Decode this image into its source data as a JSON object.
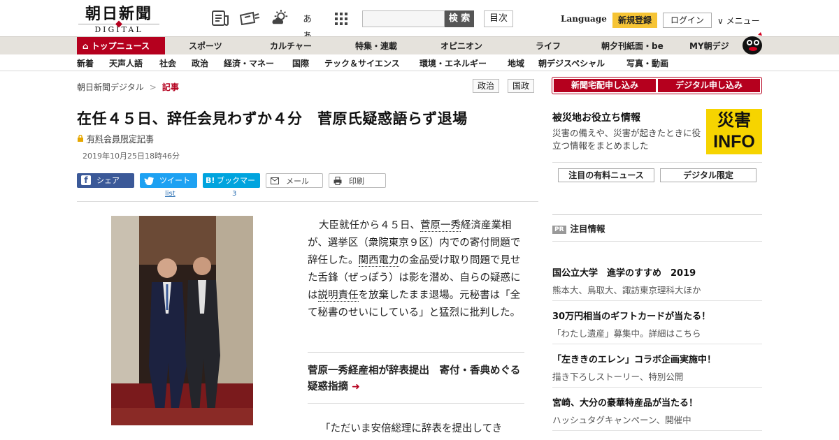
{
  "header": {
    "logo_jp": "朝日新聞",
    "logo_en": "DIGITAL",
    "icons": [
      "newspaper-icon",
      "delivery-icon",
      "weather-icon",
      "font-size-icon",
      "apps-grid-icon"
    ],
    "font_icon_text": "ぁぁ",
    "search_placeholder": "",
    "search_button": "検 索",
    "toc_button": "目次",
    "language": "Language",
    "register": "新規登録",
    "login": "ログイン",
    "menu": "∨ メニュー"
  },
  "nav_primary": [
    "トップニュース",
    "スポーツ",
    "カルチャー",
    "特集・連載",
    "オピニオン",
    "ライフ",
    "朝夕刊紙面・be",
    "MY朝デジ"
  ],
  "nav_secondary": [
    "新着",
    "天声人語",
    "社会",
    "政治",
    "経済・マネー",
    "国際",
    "テック＆サイエンス",
    "環境・エネルギー",
    "地域",
    "朝デジスペシャル",
    "写真・動画"
  ],
  "breadcrumb": {
    "home": "朝日新聞デジタル",
    "sep": ">",
    "current": "記事"
  },
  "tags": [
    "政治",
    "国政"
  ],
  "article": {
    "title": "在任４５日、辞任会見わずか４分　菅原氏疑惑語らず退場",
    "member_label": "有料会員限定記事",
    "date": "2019年10月25日18時46分",
    "share": {
      "facebook": "シェア",
      "twitter": "ツイート",
      "twitter_count": "list",
      "hatena": "ブックマーク",
      "hatena_count": "3",
      "mail": "メール",
      "print": "印刷"
    },
    "lead_parts": [
      "大臣就任から４５日、",
      "菅原一秀",
      "経済産業相が、選挙区（衆院東京９区）内での寄付問題で辞任した。",
      "関西電力",
      "の金品受け取り問題で見せた舌鋒（ぜっぽう）は影を潜め、自らの疑惑には",
      "説明責任",
      "を放棄したまま退場。元秘書は「全て秘書のせいにしている」と猛烈に批判した。"
    ],
    "related": "菅原一秀経産相が辞表提出　寄付・香典めぐる疑惑指摘",
    "body_start": "「ただいま安倍総理に辞表を提出してき"
  },
  "sidebar": {
    "subscribe_paper": "新聞宅配申し込み",
    "subscribe_digital": "デジタル申し込み",
    "disaster_title": "被災地お役立ち情報",
    "disaster_desc": "災害の備えや、災害が起きたときに役立つ情報をまとめました",
    "disaster_badge_top": "災害",
    "disaster_badge_bottom": "INFO",
    "tab_paid": "注目の有料ニュース",
    "tab_digital": "デジタル限定",
    "pr_badge": "PR",
    "pr_title": "注目情報",
    "pr_items": [
      {
        "title": "国公立大学　進学のすすめ　2019",
        "desc": "熊本大、鳥取大、諏訪東京理科大ほか"
      },
      {
        "title": "30万円相当のギフトカードが当たる！",
        "desc": "「わたし遺産」募集中。詳細はこちら"
      },
      {
        "title": "「左ききのエレン」コラボ企画実施中！",
        "desc": "描き下ろしストーリー、特別公開"
      },
      {
        "title": "宮崎、大分の豪華特産品が当たる！",
        "desc": "ハッシュタグキャンペーン、開催中"
      }
    ]
  },
  "colors": {
    "brand_red": "#b5001e",
    "register_yellow": "#f6c435",
    "facebook": "#3b5998",
    "twitter": "#1da1f2",
    "hatena": "#00a4de"
  }
}
